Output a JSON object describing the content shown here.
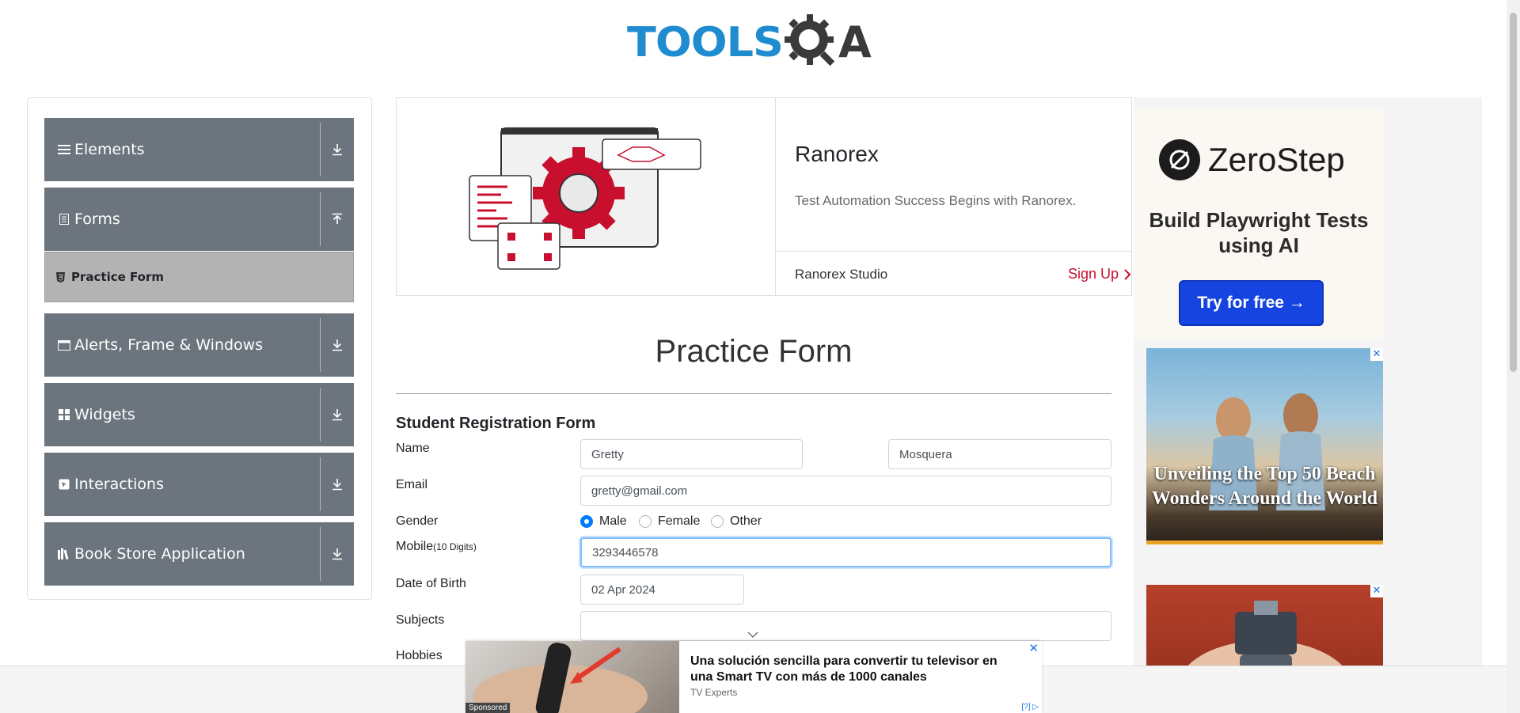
{
  "header": {
    "logo_left": "TOOLS",
    "logo_right": "A"
  },
  "sidebar": {
    "groups": [
      {
        "label": "Elements",
        "icon": "hamburger-icon"
      },
      {
        "label": "Forms",
        "icon": "document-icon"
      },
      {
        "label": "Alerts, Frame & Windows",
        "icon": "window-icon"
      },
      {
        "label": "Widgets",
        "icon": "grid-icon"
      },
      {
        "label": "Interactions",
        "icon": "cursor-icon"
      },
      {
        "label": "Book Store Application",
        "icon": "books-icon"
      }
    ],
    "active_subitem": "Practice Form"
  },
  "banner": {
    "title": "Ranorex",
    "description": "Test Automation Success Begins with Ranorex.",
    "footer_label": "Ranorex Studio",
    "cta": "Sign Up"
  },
  "ads": {
    "zerostep": {
      "brand": "ZeroStep",
      "headline": "Build Playwright Tests using AI",
      "button": "Try for free →"
    },
    "beach": {
      "headline": "Unveiling the Top 50 Beach Wonders Around the World"
    },
    "sponsored": {
      "tag": "Sponsored",
      "headline": "Una solución sencilla para convertir tu televisor en una Smart TV con más de 1000 canales",
      "source": "TV Experts",
      "info": "[?]"
    }
  },
  "form": {
    "title": "Practice Form",
    "subtitle": "Student Registration Form",
    "labels": {
      "name": "Name",
      "email": "Email",
      "gender": "Gender",
      "mobile": "Mobile",
      "mobile_hint": "(10 Digits)",
      "dob": "Date of Birth",
      "subjects": "Subjects",
      "hobbies": "Hobbies"
    },
    "first_name": "Gretty",
    "last_name": "Mosquera",
    "email": "gretty@gmail.com",
    "gender_options": [
      "Male",
      "Female",
      "Other"
    ],
    "gender_selected": "Male",
    "mobile": "3293446578",
    "dob": "02 Apr 2024",
    "subjects": ""
  },
  "colors": {
    "sidebar_group": "#6c757d",
    "sidebar_active": "#b3b3b3",
    "accent": "#1f8ccf",
    "focus": "#80bdff"
  }
}
